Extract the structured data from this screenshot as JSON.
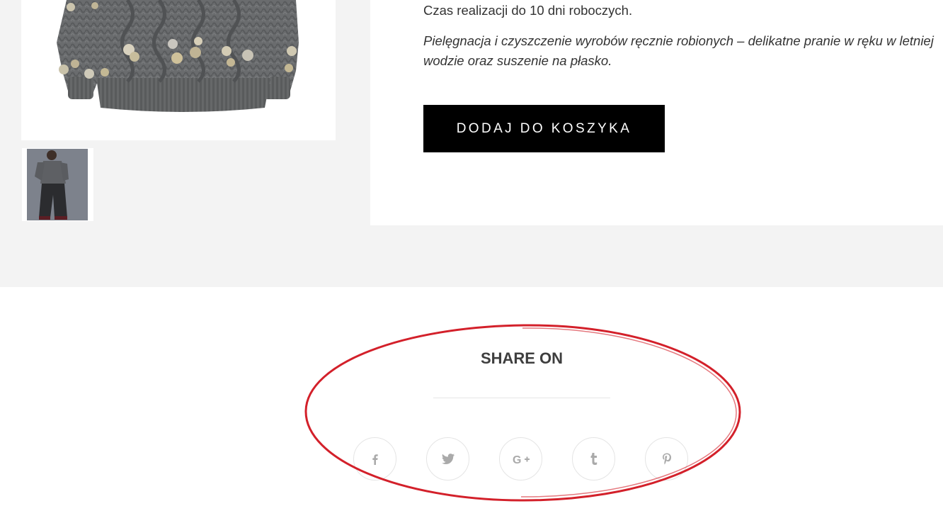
{
  "product": {
    "lead_time": "Czas realizacji do 10 dni roboczych.",
    "care_note": "Pielęgnacja i czyszczenie wyrobów ręcznie robionych – delikatne pranie w ręku w letniej wodzie oraz suszenie na płasko.",
    "add_to_cart_label": "DODAJ DO KOSZYKA"
  },
  "gallery": {
    "main_image_alt": "Szary sweter z pomponami",
    "thumbnail_alt": "Modelka w swetrze"
  },
  "share": {
    "title": "SHARE ON",
    "buttons": [
      {
        "name": "facebook",
        "icon": "facebook-icon"
      },
      {
        "name": "twitter",
        "icon": "twitter-icon"
      },
      {
        "name": "google-plus",
        "icon": "google-plus-icon"
      },
      {
        "name": "tumblr",
        "icon": "tumblr-icon"
      },
      {
        "name": "pinterest",
        "icon": "pinterest-icon"
      }
    ]
  },
  "colors": {
    "accent_button": "#000000",
    "band_background": "#f3f3f3",
    "social_icon": "#aaaaaa",
    "annotation_ring": "#d3202a"
  }
}
